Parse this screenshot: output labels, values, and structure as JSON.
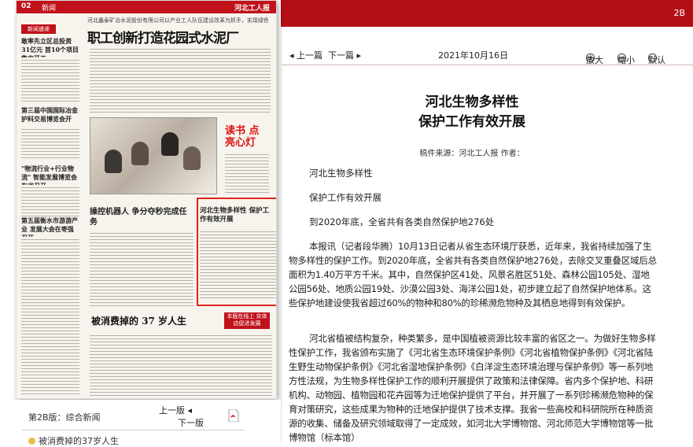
{
  "top_bar": {
    "page_label": "2B"
  },
  "nav": {
    "prev_article": "◂ 上一篇",
    "next_article": "下一篇 ▸",
    "date": "2021年10月16日",
    "zoom_in": "放大",
    "zoom_out": "缩小",
    "default": "默认"
  },
  "newspaper": {
    "page_num": "02",
    "section": "新闻",
    "brand": "河北工人报",
    "sidebar_badge": "新闻速递",
    "side_items": [
      "敢率先立区总投资31亿元 首10个项目集中开工",
      "第三届中国国际冶金 护科交易博览会开",
      "\"物流行业+行业物流\" 智能发展博览会在省召开",
      "第五届衡水市游游产业 发展大会在枣强召开"
    ],
    "top_subtitle": "河北鑫泰矿冶水泥股份有限公司以产业工人队伍建设改革为抓手，实现绿色转型升级",
    "main_headline": "职工创新打造花园式水泥厂",
    "read_lamp": "读书 点亮心灯",
    "robot_title": "操控机器人 争分夺秒完成任务",
    "highlighted_title": "河北生物多样性 保护工作有效开展",
    "bottom_headline": "被消费掉的 37 岁人生",
    "bottom_badge": "本版在线上 实体店促进发展"
  },
  "left_footer": {
    "edition": "第2B版：综合新闻",
    "prev_page": "上一版 ◂",
    "next_page": "下一版",
    "cutoff_item": "被消费掉的37岁人生"
  },
  "article": {
    "title_line1": "河北生物多样性",
    "title_line2": "保护工作有效开展",
    "source": "稿件来源：河北工人报  作者：",
    "p1": "河北生物多样性",
    "p2": "保护工作有效开展",
    "p3": "到2020年底，全省共有各类自然保护地276处",
    "p4": "本报讯（记者段华腾）10月13日记者从省生态环境厅获悉，近年来，我省持续加强了生物多样性的保护工作。到2020年底，全省共有各类自然保护地276处，去除交叉重叠区域后总面积为1.40万平方千米。其中，自然保护区41处、风景名胜区51处、森林公园105处、湿地公园56处、地质公园19处、沙漠公园3处、海洋公园1处，初步建立起了自然保护地体系。这些保护地建设使我省超过60%的物种和80%的珍稀濒危物种及其栖息地得到有效保护。",
    "p5": "河北省植被结构复杂，种类繁多，是中国植被资源比较丰富的省区之一。为做好生物多样性保护工作，我省颁布实施了《河北省生态环境保护条例》《河北省植物保护条例》《河北省陆生野生动物保护条例》《河北省湿地保护条例》《白洋淀生态环境治理与保护条例》等一系列地方性法规，为生物多样性保护工作的顺利开展提供了政策和法律保障。省内多个保护地、科研机构、动物园、植物园和花卉园等为迁地保护提供了平台，并开展了一系列珍稀濒危物种的保育对策研究，这些成果为物种的迁地保护提供了技术支撑。我省一些高校和科研院所在种质资源的收集、储备及研究领域取得了一定成效，如河北大学博物馆、河北师范大学博物馆等一批博物馆（标本馆）"
  }
}
